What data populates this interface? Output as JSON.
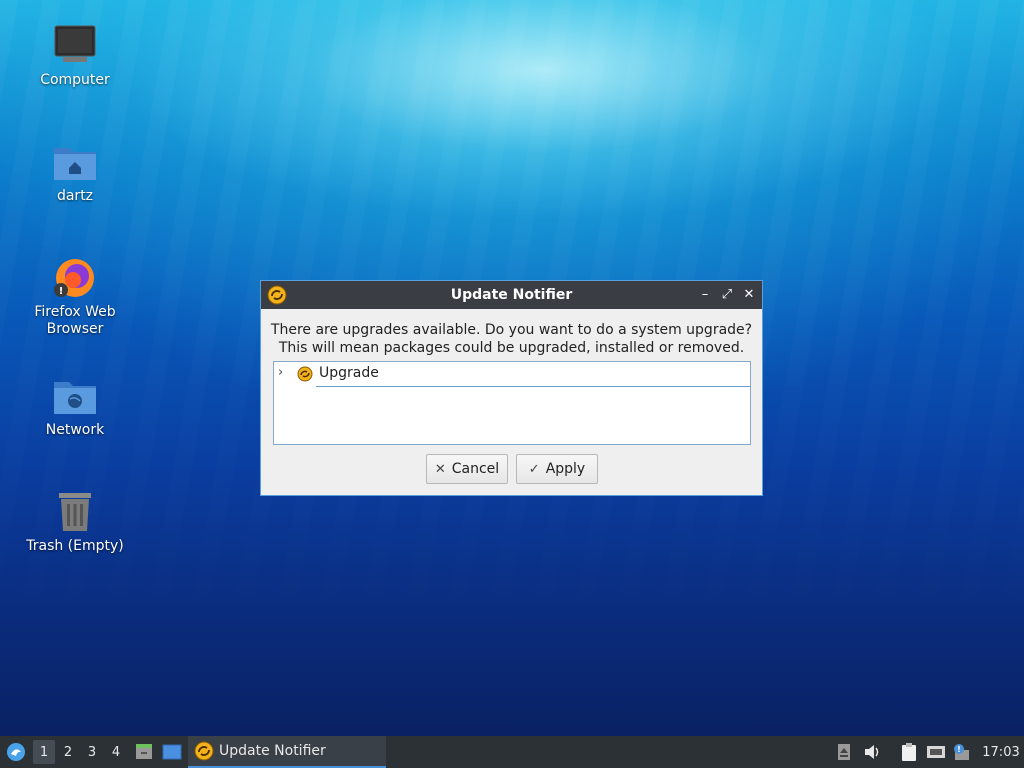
{
  "desktop": {
    "icons": [
      {
        "label": "Computer",
        "icon": "computer-icon"
      },
      {
        "label": "dartz",
        "icon": "home-folder-icon"
      },
      {
        "label": "Firefox Web Browser",
        "icon": "firefox-icon"
      },
      {
        "label": "Network",
        "icon": "network-folder-icon"
      },
      {
        "label": "Trash (Empty)",
        "icon": "trash-icon"
      }
    ]
  },
  "dialog": {
    "title": "Update Notifier",
    "message_line1": "There are upgrades available. Do you want to do a system upgrade?",
    "message_line2": "This will mean packages could be upgraded, installed or removed.",
    "tree": {
      "expander": "›",
      "item_label": "Upgrade"
    },
    "cancel_label": "Cancel",
    "apply_label": "Apply",
    "window_controls": {
      "minimize": "–",
      "maximize": "⤢",
      "close": "✕"
    }
  },
  "taskbar": {
    "workspaces": [
      "1",
      "2",
      "3",
      "4"
    ],
    "active_workspace": "1",
    "task_label": "Update Notifier",
    "clock": "17:03"
  },
  "colors": {
    "titlebar": "#3a3e44",
    "taskbar": "#2c3136",
    "accent": "#4a90d9",
    "update_icon": "#f2b21b"
  }
}
